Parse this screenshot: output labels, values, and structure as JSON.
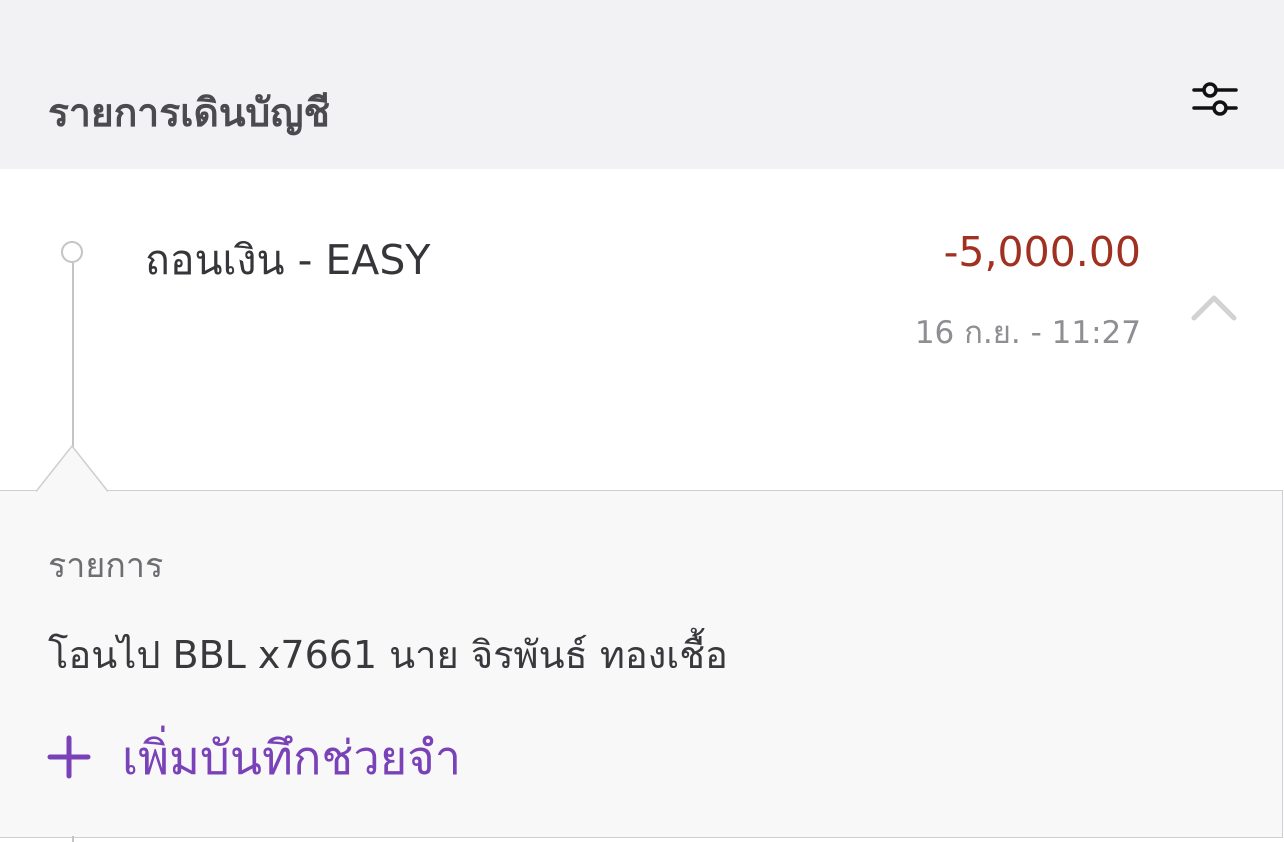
{
  "header": {
    "title": "รายการเดินบัญชี",
    "filter_icon": "filter-sliders-icon"
  },
  "transaction": {
    "title": "ถอนเงิน - EASY",
    "amount": "-5,000.00",
    "datetime": "16 ก.ย. - 11:27",
    "amount_color": "#a0301f",
    "expanded": true,
    "toggle_icon": "chevron-up-icon"
  },
  "details": {
    "label": "รายการ",
    "value": "โอนไป BBL x7661 นาย จิรพันธ์ ทองเชื้อ",
    "add_note_label": "เพิ่มบันทึกช่วยจำ",
    "add_note_icon": "plus-icon",
    "accent_color": "#7a42b8"
  }
}
